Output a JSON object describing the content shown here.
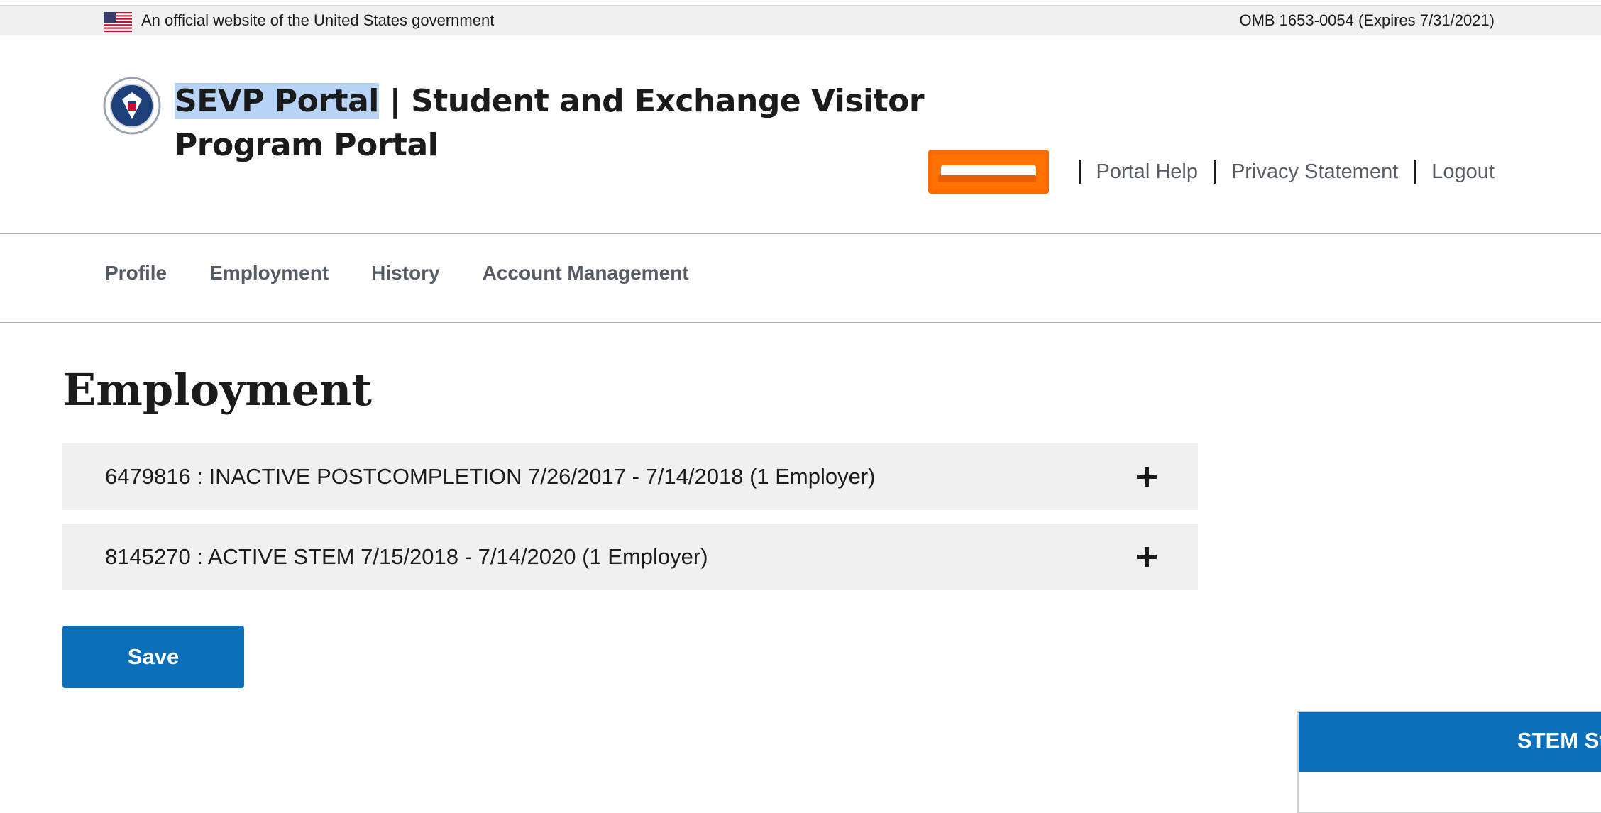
{
  "banner": {
    "official_text": "An official website of the United States government",
    "omb_text": "OMB 1653-0054 (Expires 7/31/2021)"
  },
  "header": {
    "title_highlight": "SEVP Portal",
    "title_rest": " | Student and Exchange Visitor Program Portal"
  },
  "utility_nav": {
    "items": [
      {
        "label": "Portal Help"
      },
      {
        "label": "Privacy Statement"
      },
      {
        "label": "Logout"
      }
    ]
  },
  "primary_nav": {
    "items": [
      {
        "label": "Profile"
      },
      {
        "label": "Employment"
      },
      {
        "label": "History"
      },
      {
        "label": "Account Management"
      }
    ]
  },
  "main": {
    "title": "Employment",
    "accordions": [
      {
        "label": "6479816 : INACTIVE POSTCOMPLETION 7/26/2017 - 7/14/2018 (1 Employer)"
      },
      {
        "label": "8145270 : ACTIVE STEM 7/15/2018 - 7/14/2020 (1 Employer)"
      }
    ],
    "save_label": "Save"
  },
  "side_widget": {
    "title": "STEM St"
  },
  "colors": {
    "primary_blue": "#0b6fba",
    "highlight_orange": "#ff7200",
    "banner_gray": "#f0f0f0"
  },
  "icons": [
    "us-flag-icon",
    "dhs-seal-icon",
    "plus-icon"
  ]
}
